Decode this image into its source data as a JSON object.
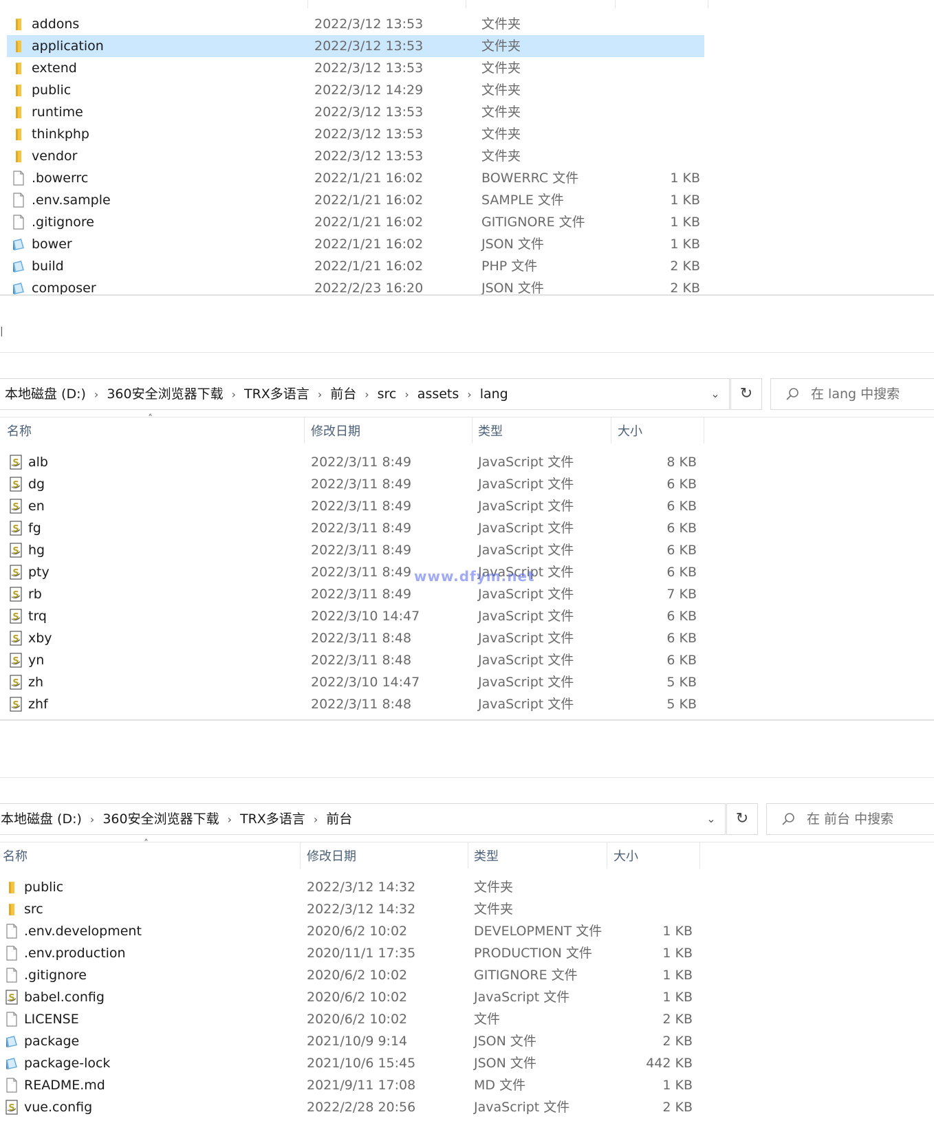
{
  "colors": {
    "selection": "#cce8ff",
    "folder": "#f5c542",
    "json_icon": "#6aaee0",
    "js_icon": "#b8a22a",
    "watermark": "#5566ee"
  },
  "top": {
    "rows": [
      {
        "icon": "folder",
        "name": "addons",
        "date": "2022/3/12 13:53",
        "type": "文件夹",
        "size": ""
      },
      {
        "icon": "folder",
        "name": "application",
        "date": "2022/3/12 13:53",
        "type": "文件夹",
        "size": "",
        "selected": true
      },
      {
        "icon": "folder",
        "name": "extend",
        "date": "2022/3/12 13:53",
        "type": "文件夹",
        "size": ""
      },
      {
        "icon": "folder",
        "name": "public",
        "date": "2022/3/12 14:29",
        "type": "文件夹",
        "size": ""
      },
      {
        "icon": "folder",
        "name": "runtime",
        "date": "2022/3/12 13:53",
        "type": "文件夹",
        "size": ""
      },
      {
        "icon": "folder",
        "name": "thinkphp",
        "date": "2022/3/12 13:53",
        "type": "文件夹",
        "size": ""
      },
      {
        "icon": "folder",
        "name": "vendor",
        "date": "2022/3/12 13:53",
        "type": "文件夹",
        "size": ""
      },
      {
        "icon": "file",
        "name": ".bowerrc",
        "date": "2022/1/21 16:02",
        "type": "BOWERRC 文件",
        "size": "1 KB"
      },
      {
        "icon": "file",
        "name": ".env.sample",
        "date": "2022/1/21 16:02",
        "type": "SAMPLE 文件",
        "size": "1 KB"
      },
      {
        "icon": "file",
        "name": ".gitignore",
        "date": "2022/1/21 16:02",
        "type": "GITIGNORE 文件",
        "size": "1 KB"
      },
      {
        "icon": "json",
        "name": "bower",
        "date": "2022/1/21 16:02",
        "type": "JSON 文件",
        "size": "1 KB"
      },
      {
        "icon": "json",
        "name": "build",
        "date": "2022/1/21 16:02",
        "type": "PHP 文件",
        "size": "2 KB"
      },
      {
        "icon": "json",
        "name": "composer",
        "date": "2022/2/23 16:20",
        "type": "JSON 文件",
        "size": "2 KB"
      }
    ]
  },
  "middle": {
    "breadcrumb": [
      "本地磁盘 (D:)",
      "360安全浏览器下载",
      "TRX多语言",
      "前台",
      "src",
      "assets",
      "lang"
    ],
    "search_placeholder": "在 lang 中搜索",
    "headers": {
      "name": "名称",
      "date": "修改日期",
      "type": "类型",
      "size": "大小"
    },
    "rows": [
      {
        "icon": "js",
        "name": "alb",
        "date": "2022/3/11 8:49",
        "type": "JavaScript 文件",
        "size": "8 KB"
      },
      {
        "icon": "js",
        "name": "dg",
        "date": "2022/3/11 8:49",
        "type": "JavaScript 文件",
        "size": "6 KB"
      },
      {
        "icon": "js",
        "name": "en",
        "date": "2022/3/11 8:49",
        "type": "JavaScript 文件",
        "size": "6 KB"
      },
      {
        "icon": "js",
        "name": "fg",
        "date": "2022/3/11 8:49",
        "type": "JavaScript 文件",
        "size": "6 KB"
      },
      {
        "icon": "js",
        "name": "hg",
        "date": "2022/3/11 8:49",
        "type": "JavaScript 文件",
        "size": "6 KB"
      },
      {
        "icon": "js",
        "name": "pty",
        "date": "2022/3/11 8:49",
        "type": "JavaScript 文件",
        "size": "6 KB"
      },
      {
        "icon": "js",
        "name": "rb",
        "date": "2022/3/11 8:49",
        "type": "JavaScript 文件",
        "size": "7 KB"
      },
      {
        "icon": "js",
        "name": "trq",
        "date": "2022/3/10 14:47",
        "type": "JavaScript 文件",
        "size": "6 KB"
      },
      {
        "icon": "js",
        "name": "xby",
        "date": "2022/3/11 8:48",
        "type": "JavaScript 文件",
        "size": "6 KB"
      },
      {
        "icon": "js",
        "name": "yn",
        "date": "2022/3/11 8:48",
        "type": "JavaScript 文件",
        "size": "6 KB"
      },
      {
        "icon": "js",
        "name": "zh",
        "date": "2022/3/10 14:47",
        "type": "JavaScript 文件",
        "size": "5 KB"
      },
      {
        "icon": "js",
        "name": "zhf",
        "date": "2022/3/11 8:48",
        "type": "JavaScript 文件",
        "size": "5 KB"
      }
    ]
  },
  "watermark": "www.dfym.net",
  "bottom": {
    "breadcrumb": [
      "本地磁盘 (D:)",
      "360安全浏览器下载",
      "TRX多语言",
      "前台"
    ],
    "search_placeholder": "在 前台 中搜索",
    "headers": {
      "name": "名称",
      "date": "修改日期",
      "type": "类型",
      "size": "大小"
    },
    "rows": [
      {
        "icon": "folder",
        "name": "public",
        "date": "2022/3/12 14:32",
        "type": "文件夹",
        "size": ""
      },
      {
        "icon": "folder",
        "name": "src",
        "date": "2022/3/12 14:32",
        "type": "文件夹",
        "size": ""
      },
      {
        "icon": "file",
        "name": ".env.development",
        "date": "2020/6/2 10:02",
        "type": "DEVELOPMENT 文件",
        "size": "1 KB"
      },
      {
        "icon": "file",
        "name": ".env.production",
        "date": "2020/11/1 17:35",
        "type": "PRODUCTION 文件",
        "size": "1 KB"
      },
      {
        "icon": "file",
        "name": ".gitignore",
        "date": "2020/6/2 10:02",
        "type": "GITIGNORE 文件",
        "size": "1 KB"
      },
      {
        "icon": "js",
        "name": "babel.config",
        "date": "2020/6/2 10:02",
        "type": "JavaScript 文件",
        "size": "1 KB"
      },
      {
        "icon": "file",
        "name": "LICENSE",
        "date": "2020/6/2 10:02",
        "type": "文件",
        "size": "2 KB"
      },
      {
        "icon": "json",
        "name": "package",
        "date": "2021/10/9 9:14",
        "type": "JSON 文件",
        "size": "2 KB"
      },
      {
        "icon": "json",
        "name": "package-lock",
        "date": "2021/10/6 15:45",
        "type": "JSON 文件",
        "size": "442 KB"
      },
      {
        "icon": "file",
        "name": "README.md",
        "date": "2021/9/11 17:08",
        "type": "MD 文件",
        "size": "1 KB"
      },
      {
        "icon": "js",
        "name": "vue.config",
        "date": "2022/2/28 20:56",
        "type": "JavaScript 文件",
        "size": "2 KB"
      }
    ]
  }
}
